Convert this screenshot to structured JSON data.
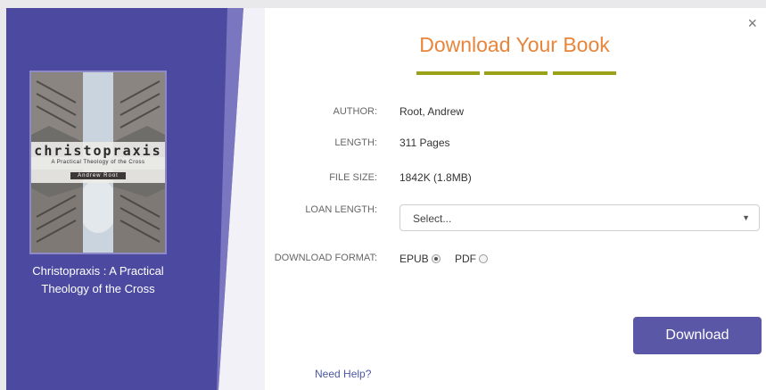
{
  "dialog": {
    "title": "Download Your Book",
    "close_icon": "close-icon",
    "close_glyph": "×"
  },
  "colors": {
    "sidebar": "#4c4aa0",
    "sidebar_stripe": "#7a76c0",
    "heading": "#e8853a",
    "underline": "#9aa21a",
    "button": "#5a57a6",
    "help_link": "#4c58a4"
  },
  "book": {
    "title": "Christopraxis : A Practical Theology of the Cross",
    "cover": {
      "title": "christopraxis",
      "subtitle": "A Practical Theology of the Cross",
      "author": "Andrew Root"
    }
  },
  "details": {
    "author": {
      "label": "AUTHOR:",
      "value": "Root, Andrew"
    },
    "length": {
      "label": "LENGTH:",
      "value": "311 Pages"
    },
    "file_size": {
      "label": "FILE SIZE:",
      "value": "1842K (1.8MB)"
    },
    "loan_length": {
      "label": "LOAN LENGTH:",
      "selected": "Select..."
    },
    "format": {
      "label": "DOWNLOAD FORMAT:",
      "options": [
        {
          "label": "EPUB",
          "selected": true
        },
        {
          "label": "PDF",
          "selected": false
        }
      ]
    }
  },
  "actions": {
    "download_label": "Download",
    "help_label": "Need Help?"
  }
}
